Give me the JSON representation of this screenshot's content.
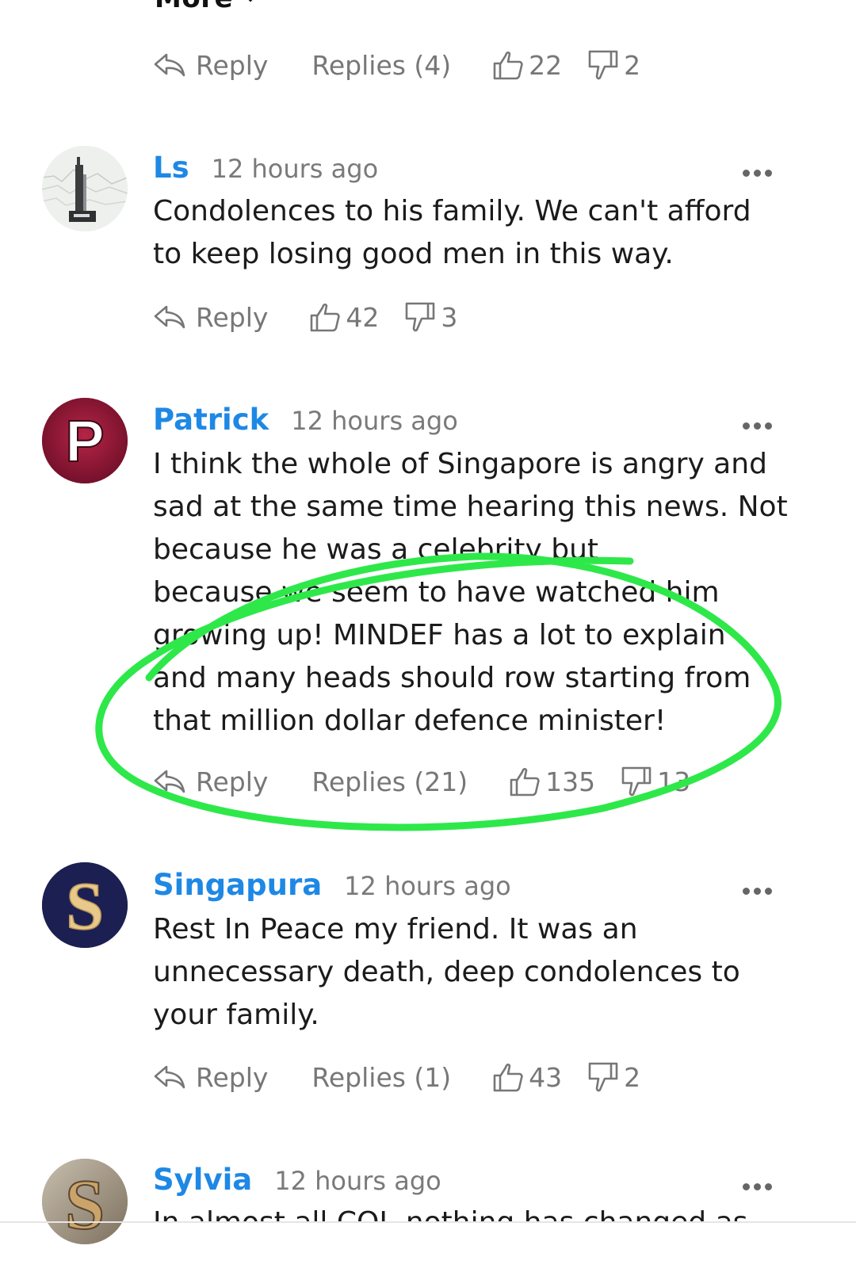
{
  "top": {
    "more_label": "More",
    "reply_label": "Reply",
    "replies_label": "Replies (4)",
    "likes": "22",
    "dislikes": "2"
  },
  "comments": [
    {
      "author": "Ls",
      "time": "12 hours ago",
      "lines": [
        "Condolences to his family. We can't afford",
        "to keep losing good men in this way."
      ],
      "reply_label": "Reply",
      "replies_label": "",
      "likes": "42",
      "dislikes": "3"
    },
    {
      "author": "Patrick",
      "time": "12 hours ago",
      "avatar_letter": "P",
      "lines": [
        "I think the whole of Singapore is angry and",
        "sad at the same time hearing this news. Not",
        "because he was a celebrity but",
        "because we seem to have watched him",
        "growing up! MINDEF has a lot to explain",
        "and many heads should row starting from",
        "that million dollar defence minister!"
      ],
      "reply_label": "Reply",
      "replies_label": "Replies (21)",
      "likes": "135",
      "dislikes": "13"
    },
    {
      "author": "Singapura",
      "time": "12 hours ago",
      "avatar_letter": "S",
      "lines": [
        "Rest In Peace my friend. It was an",
        "unnecessary death, deep condolences to",
        "your family."
      ],
      "reply_label": "Reply",
      "replies_label": "Replies (1)",
      "likes": "43",
      "dislikes": "2"
    },
    {
      "author": "Sylvia",
      "time": "12 hours ago",
      "avatar_letter": "S",
      "lines": [
        "In almost all COI, nothing has changed as"
      ]
    }
  ],
  "colors": {
    "author": "#1e88e5",
    "meta": "#7a7a7a",
    "action": "#777777",
    "highlight_stroke": "#2ee84a",
    "patrick_avatar": "#9b1c3a",
    "singapura_avatar": "#1c1f52",
    "singapura_letter": "#e8c98a"
  }
}
